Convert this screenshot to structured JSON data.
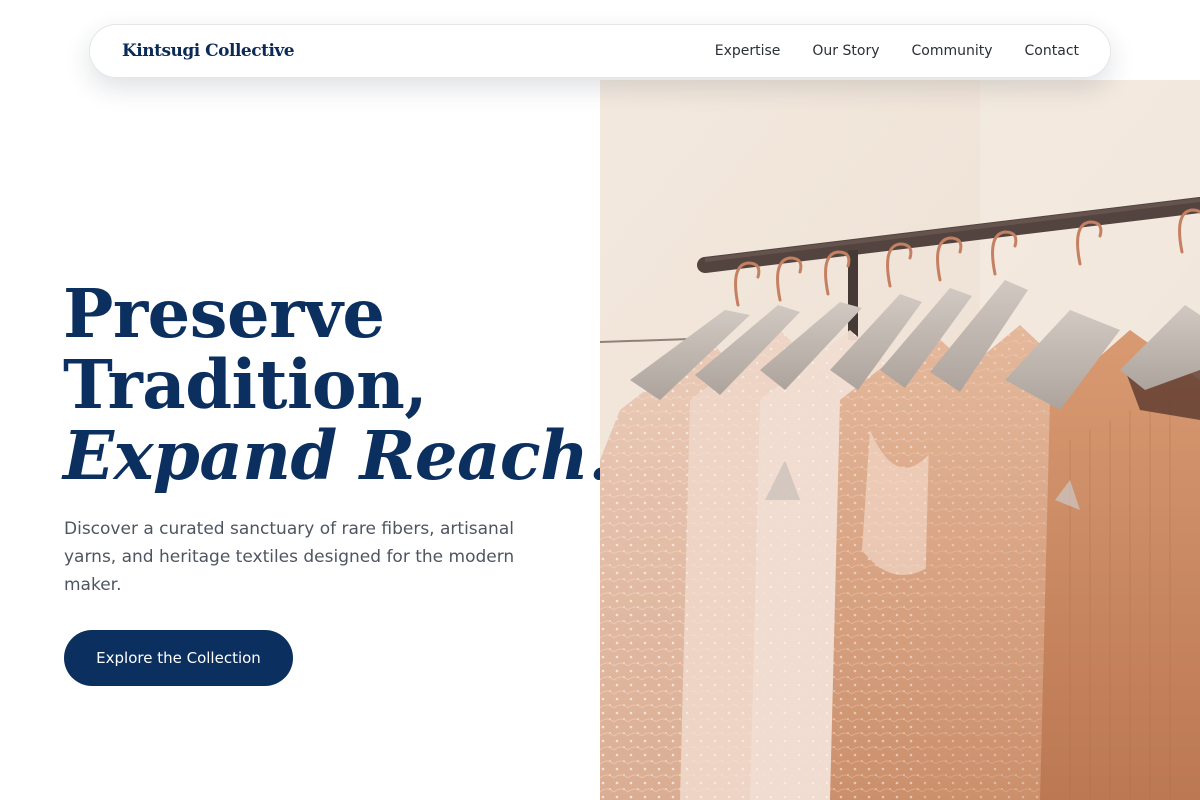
{
  "brand": {
    "name": "Kintsugi Collective"
  },
  "nav": {
    "links": [
      {
        "label": "Expertise"
      },
      {
        "label": "Our Story"
      },
      {
        "label": "Community"
      },
      {
        "label": "Contact"
      }
    ]
  },
  "hero": {
    "title_line1": "Preserve",
    "title_line2": "Tradition,",
    "title_line3": "Expand Reach.",
    "description": "Discover a curated sanctuary of rare fibers, artisanal yarns, and heritage textiles designed for the modern maker.",
    "cta_label": "Explore the Collection"
  },
  "image": {
    "subject": "garments-on-clothing-rack"
  },
  "colors": {
    "primary": "#0b2f5e",
    "brand_text": "#0b2a55",
    "body_text": "#4f5560",
    "nav_text": "#2b2f36",
    "background": "#ffffff"
  }
}
